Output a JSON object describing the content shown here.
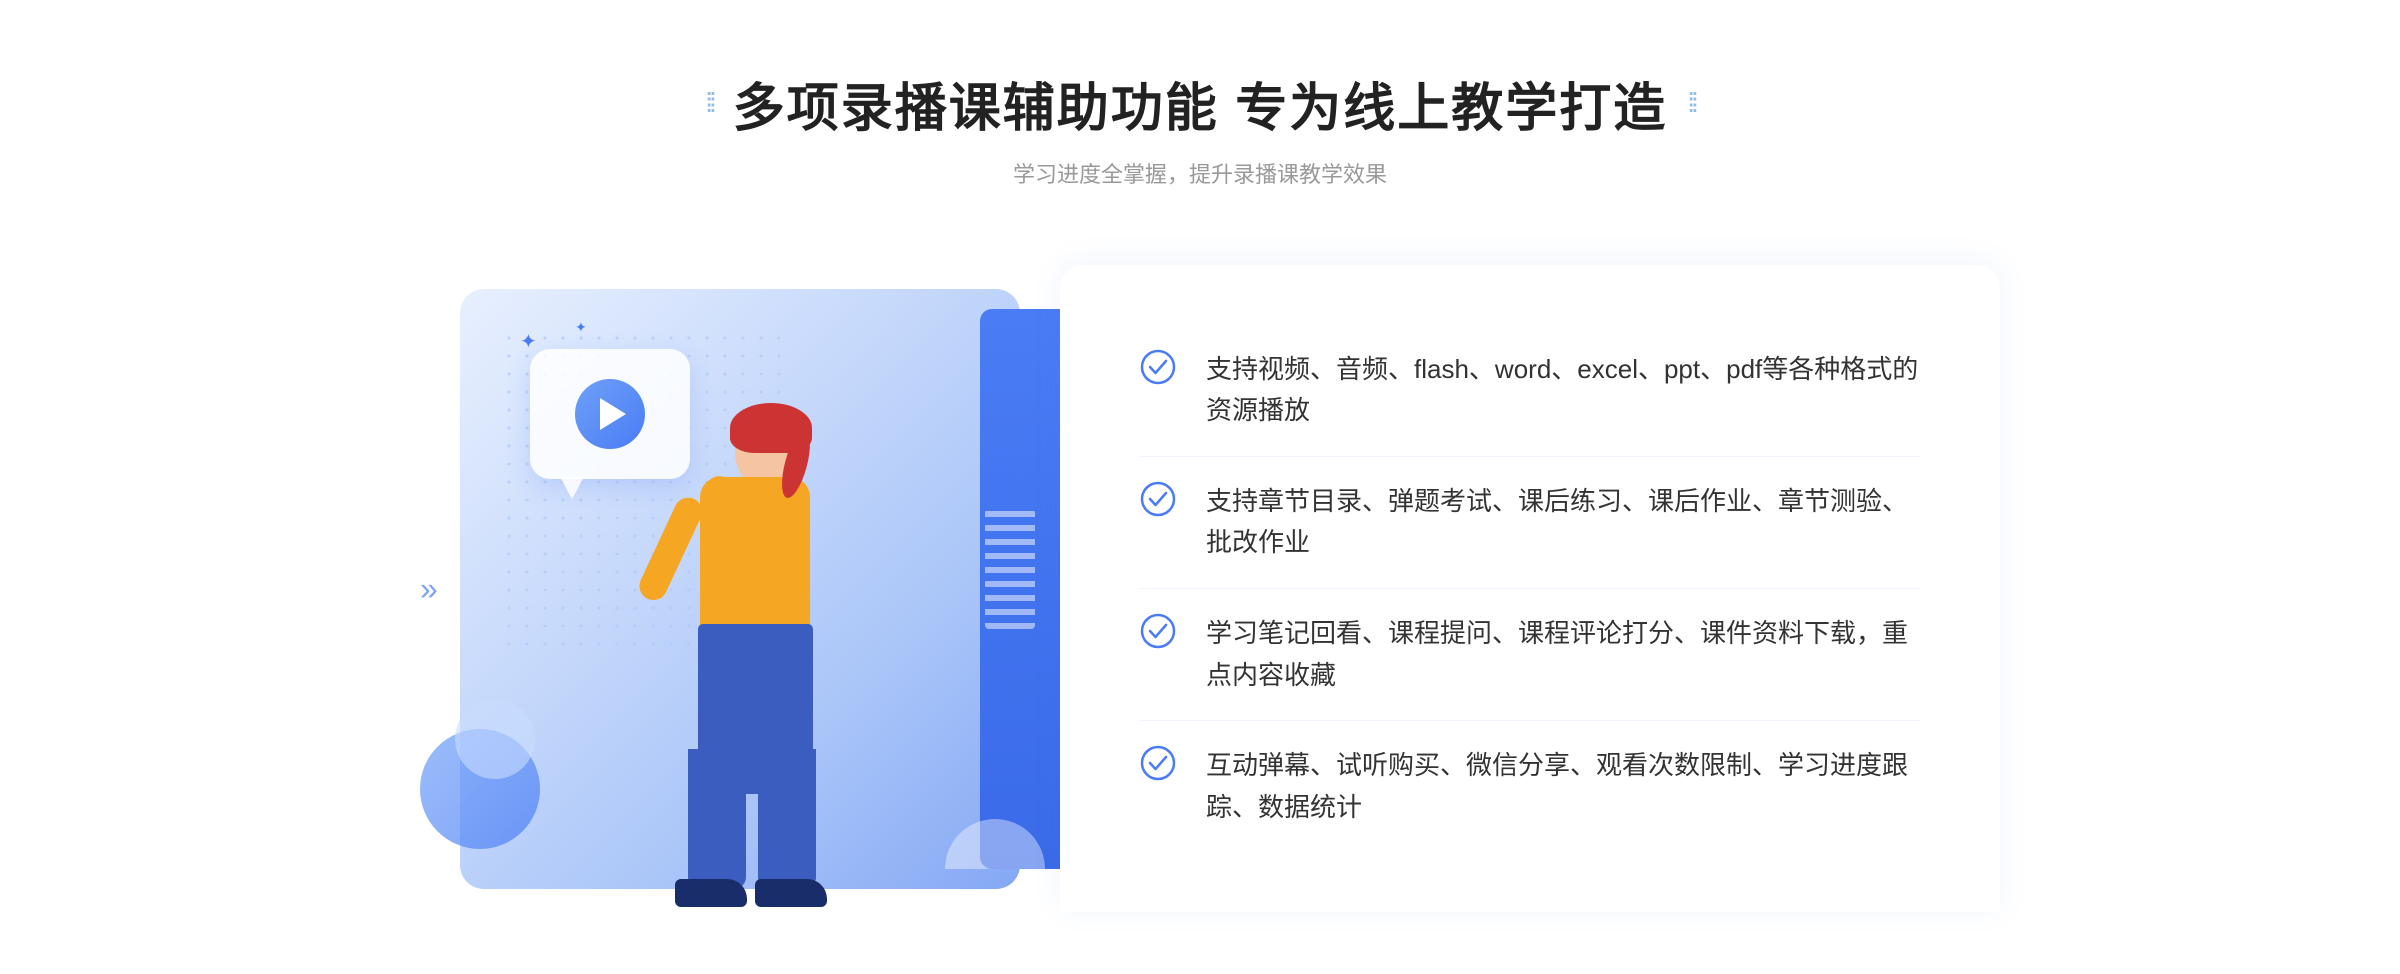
{
  "header": {
    "dots_left": "⁞⁞",
    "dots_right": "⁞⁞",
    "title": "多项录播课辅助功能 专为线上教学打造",
    "subtitle": "学习进度全掌握，提升录播课教学效果"
  },
  "features": [
    {
      "id": "feature-1",
      "text": "支持视频、音频、flash、word、excel、ppt、pdf等各种格式的资源播放"
    },
    {
      "id": "feature-2",
      "text": "支持章节目录、弹题考试、课后练习、课后作业、章节测验、批改作业"
    },
    {
      "id": "feature-3",
      "text": "学习笔记回看、课程提问、课程评论打分、课件资料下载，重点内容收藏"
    },
    {
      "id": "feature-4",
      "text": "互动弹幕、试听购买、微信分享、观看次数限制、学习进度跟踪、数据统计"
    }
  ],
  "illustration": {
    "play_tooltip": "播放视频",
    "chevron_symbol": "»"
  },
  "colors": {
    "primary": "#4a7cf5",
    "title": "#222222",
    "subtitle": "#999999",
    "text": "#333333",
    "check": "#4a7cf5"
  }
}
